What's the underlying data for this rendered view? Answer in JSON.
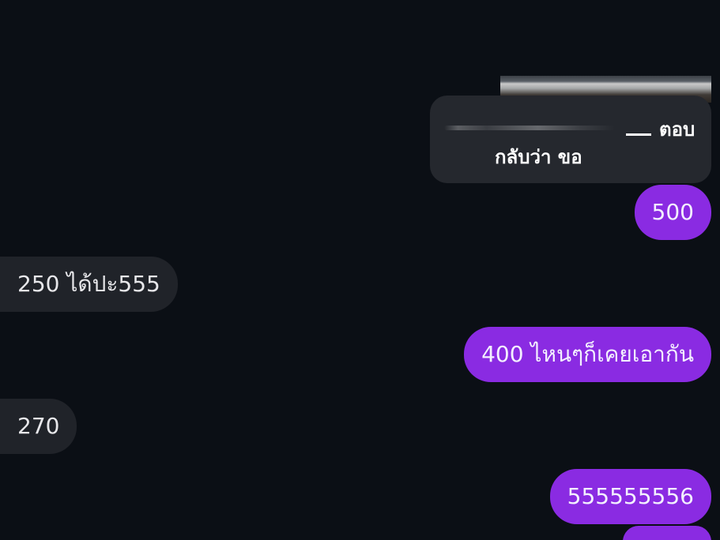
{
  "reply": {
    "line1": "ตอบ",
    "line2": "กลับว่า ขอ"
  },
  "messages": [
    {
      "dir": "out",
      "text": "500"
    },
    {
      "dir": "in",
      "text": "250 ได้ปะ555"
    },
    {
      "dir": "out",
      "text": "400 ไหนๆก็เคยเอากัน"
    },
    {
      "dir": "in",
      "text": "270"
    },
    {
      "dir": "out",
      "text": "555555556"
    }
  ],
  "colors": {
    "background": "#0b0f15",
    "outgoing_bubble": "#8a2be2",
    "incoming_bubble": "#202329",
    "reply_card": "#25282e"
  }
}
